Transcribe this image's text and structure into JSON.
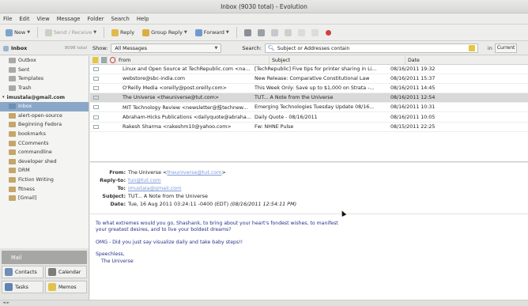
{
  "window": {
    "title": "Inbox (9030 total) - Evolution"
  },
  "menu": [
    "File",
    "Edit",
    "View",
    "Message",
    "Folder",
    "Search",
    "Help"
  ],
  "toolbar": {
    "new_label": "New",
    "send_receive_label": "Send / Receive",
    "reply_label": "Reply",
    "group_reply_label": "Group Reply",
    "forward_label": "Forward"
  },
  "search": {
    "folder_label": "Inbox",
    "unread_label": "9098 total",
    "show_label": "Show:",
    "show_value": "All Messages",
    "search_label": "Search:",
    "placeholder": "Subject or Addresses contain",
    "in_label": "in",
    "in_value": "Current"
  },
  "sidebar": {
    "items": [
      {
        "label": "Outbox",
        "level": "l1",
        "icon": "outbox-icon"
      },
      {
        "label": "Sent",
        "level": "l1",
        "icon": "sent-icon"
      },
      {
        "label": "Templates",
        "level": "l1",
        "icon": "templates-icon"
      },
      {
        "label": "Trash",
        "level": "l1",
        "icon": "trash-icon"
      },
      {
        "label": "imustala@gmail.com",
        "level": "acct",
        "icon": ""
      },
      {
        "label": "Inbox",
        "level": "l2",
        "icon": "inbox-icon",
        "selected": true
      },
      {
        "label": "alert-open-source",
        "level": "l2",
        "icon": "folder-icon"
      },
      {
        "label": "Beginning Fedora",
        "level": "l2",
        "icon": "folder-icon"
      },
      {
        "label": "bookmarks",
        "level": "l2",
        "icon": "folder-icon"
      },
      {
        "label": "CComments",
        "level": "l2",
        "icon": "folder-icon"
      },
      {
        "label": "commandline",
        "level": "l2",
        "icon": "folder-icon"
      },
      {
        "label": "developer shed",
        "level": "l2",
        "icon": "folder-icon"
      },
      {
        "label": "DRM",
        "level": "l2",
        "icon": "folder-icon"
      },
      {
        "label": "Fiction Writing",
        "level": "l2",
        "icon": "folder-icon"
      },
      {
        "label": "fitness",
        "level": "l2",
        "icon": "folder-icon"
      },
      {
        "label": "[Gmail]",
        "level": "l2",
        "icon": "folder-icon"
      }
    ]
  },
  "switcher": {
    "mail_label": "Mail",
    "contacts_label": "Contacts",
    "calendar_label": "Calendar",
    "tasks_label": "Tasks",
    "memos_label": "Memos"
  },
  "list": {
    "headers": {
      "from": "From",
      "subject": "Subject",
      "date": "Date"
    },
    "rows": [
      {
        "from": "Linux and Open Source at TechRepublic.com <na...",
        "subject": "[TechRepublic] Five tips for printer sharing in Li...",
        "date": "08/16/2011 19:32"
      },
      {
        "from": "webstore@sbc-india.com",
        "subject": "New Release: Comparative Constitutional Law",
        "date": "08/16/2011 15:37"
      },
      {
        "from": "O'Reilly Media <oreilly@post.oreilly.com>",
        "subject": "This Week Only: Save up to $1,000 on Strata -...",
        "date": "08/16/2011 14:45"
      },
      {
        "from": "The Universe <theuniverse@tut.com>",
        "subject": "TUT... A Note from the Universe",
        "date": "08/16/2011 12:54",
        "selected": true
      },
      {
        "from": "MIT Technology Review <newsletter@技technew...",
        "subject": "Emerging Technologies Tuesday Update 08/16...",
        "date": "08/16/2011 10:31"
      },
      {
        "from": "Abraham-Hicks Publications <dailyquote@abraha...",
        "subject": "Daily Quote - 08/16/2011",
        "date": "08/16/2011 10:05"
      },
      {
        "from": "Rakesh Sharma <rakeshm10@yahoo.com>",
        "subject": "Fw: NHNE Pulse",
        "date": "08/15/2011 22:25"
      }
    ]
  },
  "preview": {
    "from_label": "From:",
    "from_name": "The Universe <",
    "from_email": "theuniverse@tut.com",
    "from_end": ">",
    "replyto_label": "Reply-to:",
    "replyto_value": "fun@tut.com",
    "to_label": "To:",
    "to_value": "imustala@gmail.com",
    "subject_label": "Subject:",
    "subject_value": "TUT... A Note from the Universe",
    "date_label": "Date:",
    "date_value": "Tue, 16 Aug 2011 03:24:11 -0400 (EDT) ",
    "date_local": "(08/16/2011 12:54:11 PM)",
    "body_line1": "To what extremes would you go, Shashank, to bring about your heart's fondest wishes, to manifest",
    "body_line2": "your greatest desires, and to live your boldest dreams?",
    "body_line3": "OMG - Did you just say visualize daily and take baby steps!!",
    "body_line4": "Speechless,",
    "body_line5": "The Universe"
  },
  "status": {
    "text": "◄ ►"
  }
}
